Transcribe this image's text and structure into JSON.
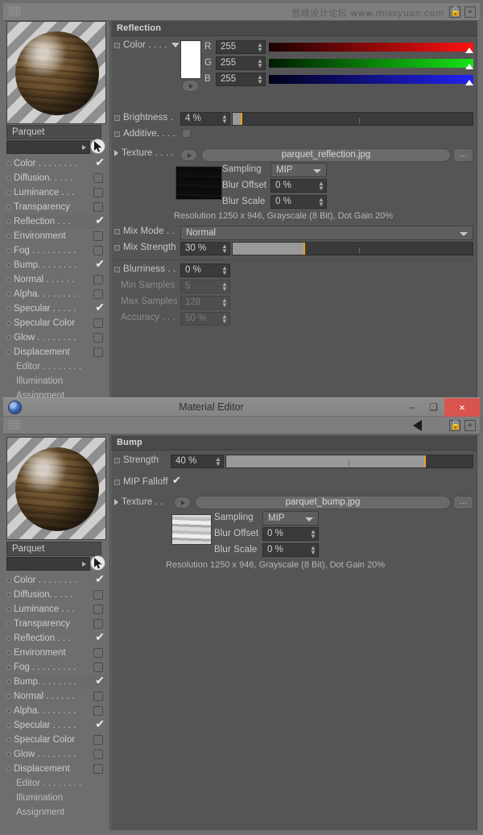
{
  "watermark": "思缘设计论坛 www.missyuan.com",
  "window": {
    "title": "Material Editor",
    "minimize_label": "–",
    "maximize_label": "❑",
    "close_label": "×",
    "logo_name": "cinema4d-logo"
  },
  "toolbar": {
    "back_label": "",
    "lock_label": "🔓",
    "add_label": "+"
  },
  "material": {
    "name": "Parquet",
    "search_value": ""
  },
  "channels": [
    {
      "label": "Color . . . . . . . .",
      "checked": true,
      "selected_top": false,
      "selected_bottom": false
    },
    {
      "label": "Diffusion. . . . .",
      "checked": false,
      "selected_top": false,
      "selected_bottom": false
    },
    {
      "label": "Luminance . . .",
      "checked": false,
      "selected_top": false,
      "selected_bottom": false
    },
    {
      "label": "Transparency",
      "checked": false,
      "selected_top": false,
      "selected_bottom": false
    },
    {
      "label": "Reflection . . .",
      "checked": true,
      "selected_top": true,
      "selected_bottom": false
    },
    {
      "label": "Environment",
      "checked": false,
      "selected_top": false,
      "selected_bottom": false
    },
    {
      "label": "Fog . . . . . . . . .",
      "checked": false,
      "selected_top": false,
      "selected_bottom": false
    },
    {
      "label": "Bump. . . . . . . .",
      "checked": true,
      "selected_top": false,
      "selected_bottom": true
    },
    {
      "label": "Normal . . . . . .",
      "checked": false,
      "selected_top": false,
      "selected_bottom": false
    },
    {
      "label": "Alpha. . . . . . . .",
      "checked": false,
      "selected_top": false,
      "selected_bottom": false
    },
    {
      "label": "Specular . . . . .",
      "checked": true,
      "selected_top": false,
      "selected_bottom": false
    },
    {
      "label": "Specular Color",
      "checked": false,
      "selected_top": false,
      "selected_bottom": false
    },
    {
      "label": "Glow . . . . . . . .",
      "checked": false,
      "selected_top": false,
      "selected_bottom": false
    },
    {
      "label": "Displacement",
      "checked": false,
      "selected_top": false,
      "selected_bottom": false
    }
  ],
  "channel_pages": [
    {
      "label": "Editor . . . . . . . ."
    },
    {
      "label": "Illumination"
    },
    {
      "label": "Assignment"
    }
  ],
  "reflection": {
    "section_title": "Reflection",
    "color_label": "Color . . . .",
    "color_swatch": "#ffffff",
    "rgb": [
      {
        "channel": "R",
        "value": "255",
        "bar_from": "#1a0000",
        "bar_to": "#ff1212",
        "knob_pct": 100
      },
      {
        "channel": "G",
        "value": "255",
        "bar_from": "#001a00",
        "bar_to": "#15e515",
        "knob_pct": 100
      },
      {
        "channel": "B",
        "value": "255",
        "bar_from": "#000018",
        "bar_to": "#2222f2",
        "knob_pct": 100
      }
    ],
    "brightness_label": "Brightness .",
    "brightness_value": "4 %",
    "brightness_pct": 4,
    "additive_label": "Additive. . . .",
    "additive_checked": false,
    "texture_label": "Texture . . . .",
    "texture_file": "parquet_reflection.jpg",
    "browse_label": "...",
    "sampling_label": "Sampling",
    "sampling_value": "MIP",
    "blur_offset_label": "Blur Offset",
    "blur_offset_value": "0 %",
    "blur_scale_label": "Blur Scale",
    "blur_scale_value": "0 %",
    "resolution_text": "Resolution 1250 x 946, Grayscale (8 Bit), Dot Gain 20%",
    "mix_mode_label": "Mix Mode . .",
    "mix_mode_value": "Normal",
    "mix_strength_label": "Mix Strength",
    "mix_strength_value": "30 %",
    "mix_strength_pct": 30,
    "blurriness_label": "Blurriness . .",
    "blurriness_value": "0 %",
    "min_samples_label": "Min Samples",
    "min_samples_value": "5",
    "max_samples_label": "Max Samples",
    "max_samples_value": "128",
    "accuracy_label": "Accuracy . . .",
    "accuracy_value": "50 %"
  },
  "bump": {
    "section_title": "Bump",
    "strength_label": "Strength",
    "strength_value": "40 %",
    "strength_pct": 80,
    "mip_falloff_label": "MIP Falloff",
    "mip_falloff_checked": true,
    "texture_label": "Texture . .",
    "texture_file": "parquet_bump.jpg",
    "browse_label": "...",
    "sampling_label": "Sampling",
    "sampling_value": "MIP",
    "blur_offset_label": "Blur Offset",
    "blur_offset_value": "0 %",
    "blur_scale_label": "Blur Scale",
    "blur_scale_value": "0 %",
    "resolution_text": "Resolution 1250 x 946, Grayscale (8 Bit), Dot Gain 20%"
  }
}
